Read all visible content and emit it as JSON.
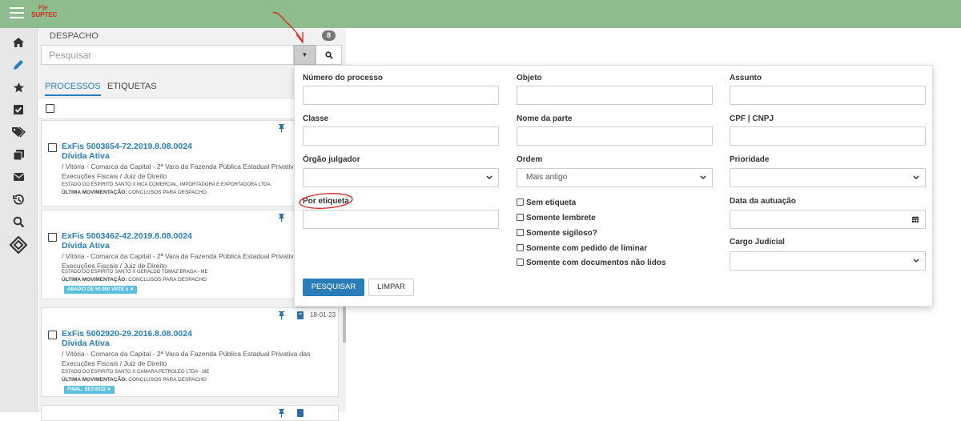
{
  "logo": {
    "line1": "Pje",
    "line2": "SUPTEC"
  },
  "sidebar": {
    "icons": [
      "home-icon",
      "pencil-icon",
      "star-icon",
      "checkbox-icon",
      "tags-icon",
      "copy-icon",
      "envelope-icon",
      "history-icon",
      "search-icon",
      "diamond-icon"
    ]
  },
  "panel": {
    "title": "DESPACHO",
    "count": "8",
    "search_placeholder": "Pesquisar",
    "tabs": [
      "PROCESSOS",
      "ETIQUETAS"
    ]
  },
  "cards": [
    {
      "number": "ExFis 5003654-72.2019.8.08.0024",
      "class": "Dívida Ativa",
      "location1": "/ Vitória - Comarca da Capital - 2ª Vara da Fazenda Pública Estadual Privativa",
      "location2": "Execuções Fiscais / Juiz de Direito",
      "parties": "ESTADO DO ESPIRITO SANTO X MCA COMERCIAL, IMPORTADORA E EXPORTADORA LTDA.",
      "mov_label": "ÚLTIMA MOVIMENTAÇÃO:",
      "mov_value": "CONCLUSOS PARA DESPACHO"
    },
    {
      "number": "ExFis 5003462-42.2019.8.08.0024",
      "class": "Dívida Ativa",
      "location1": "/ Vitória - Comarca da Capital - 2ª Vara da Fazenda Pública Estadual Privativa",
      "location2": "Execuções Fiscais / Juiz de Direito",
      "parties": "ESTADO DO ESPIRITO SANTO X GERALDO TOMAZ BRAGA - ME",
      "mov_label": "ÚLTIMA MOVIMENTAÇÃO:",
      "mov_value": "CONCLUSOS PARA DESPACHO",
      "tag": "ABAIXO DE 50.000 VRTE´s ✕"
    },
    {
      "number": "ExFis 5002920-29.2016.8.08.0024",
      "class": "Dívida Ativa",
      "date": "18-01-23",
      "location1": "/ Vitória - Comarca da Capital - 2ª Vara da Fazenda Pública Estadual Privativa das",
      "location2": "Execuções Fiscais / Juiz de Direito",
      "parties": "ESTADO DO ESPIRITO SANTO X CAMARA PETROLEO LTDA - ME",
      "mov_label": "ÚLTIMA MOVIMENTAÇÃO:",
      "mov_value": "CONCLUSOS PARA DESPACHO",
      "tag": "FINAL: SET/2022 ✕"
    }
  ],
  "filters": {
    "numero": "Número do processo",
    "objeto": "Objeto",
    "assunto": "Assunto",
    "classe": "Classe",
    "nome_parte": "Nome da parte",
    "cpf": "CPF | CNPJ",
    "orgao": "Órgão julgador",
    "ordem": "Ordem",
    "ordem_value": "Mais antigo",
    "prioridade": "Prioridade",
    "etiqueta": "Por etiqueta",
    "data_autuacao": "Data da autuação",
    "cargo": "Cargo Judicial",
    "checks": [
      "Sem etiqueta",
      "Somente lembrete",
      "Somente sigiloso?",
      "Somente com pedido de liminar",
      "Somente com documentos não lidos"
    ],
    "btn_search": "PESQUISAR",
    "btn_clear": "LIMPAR"
  }
}
